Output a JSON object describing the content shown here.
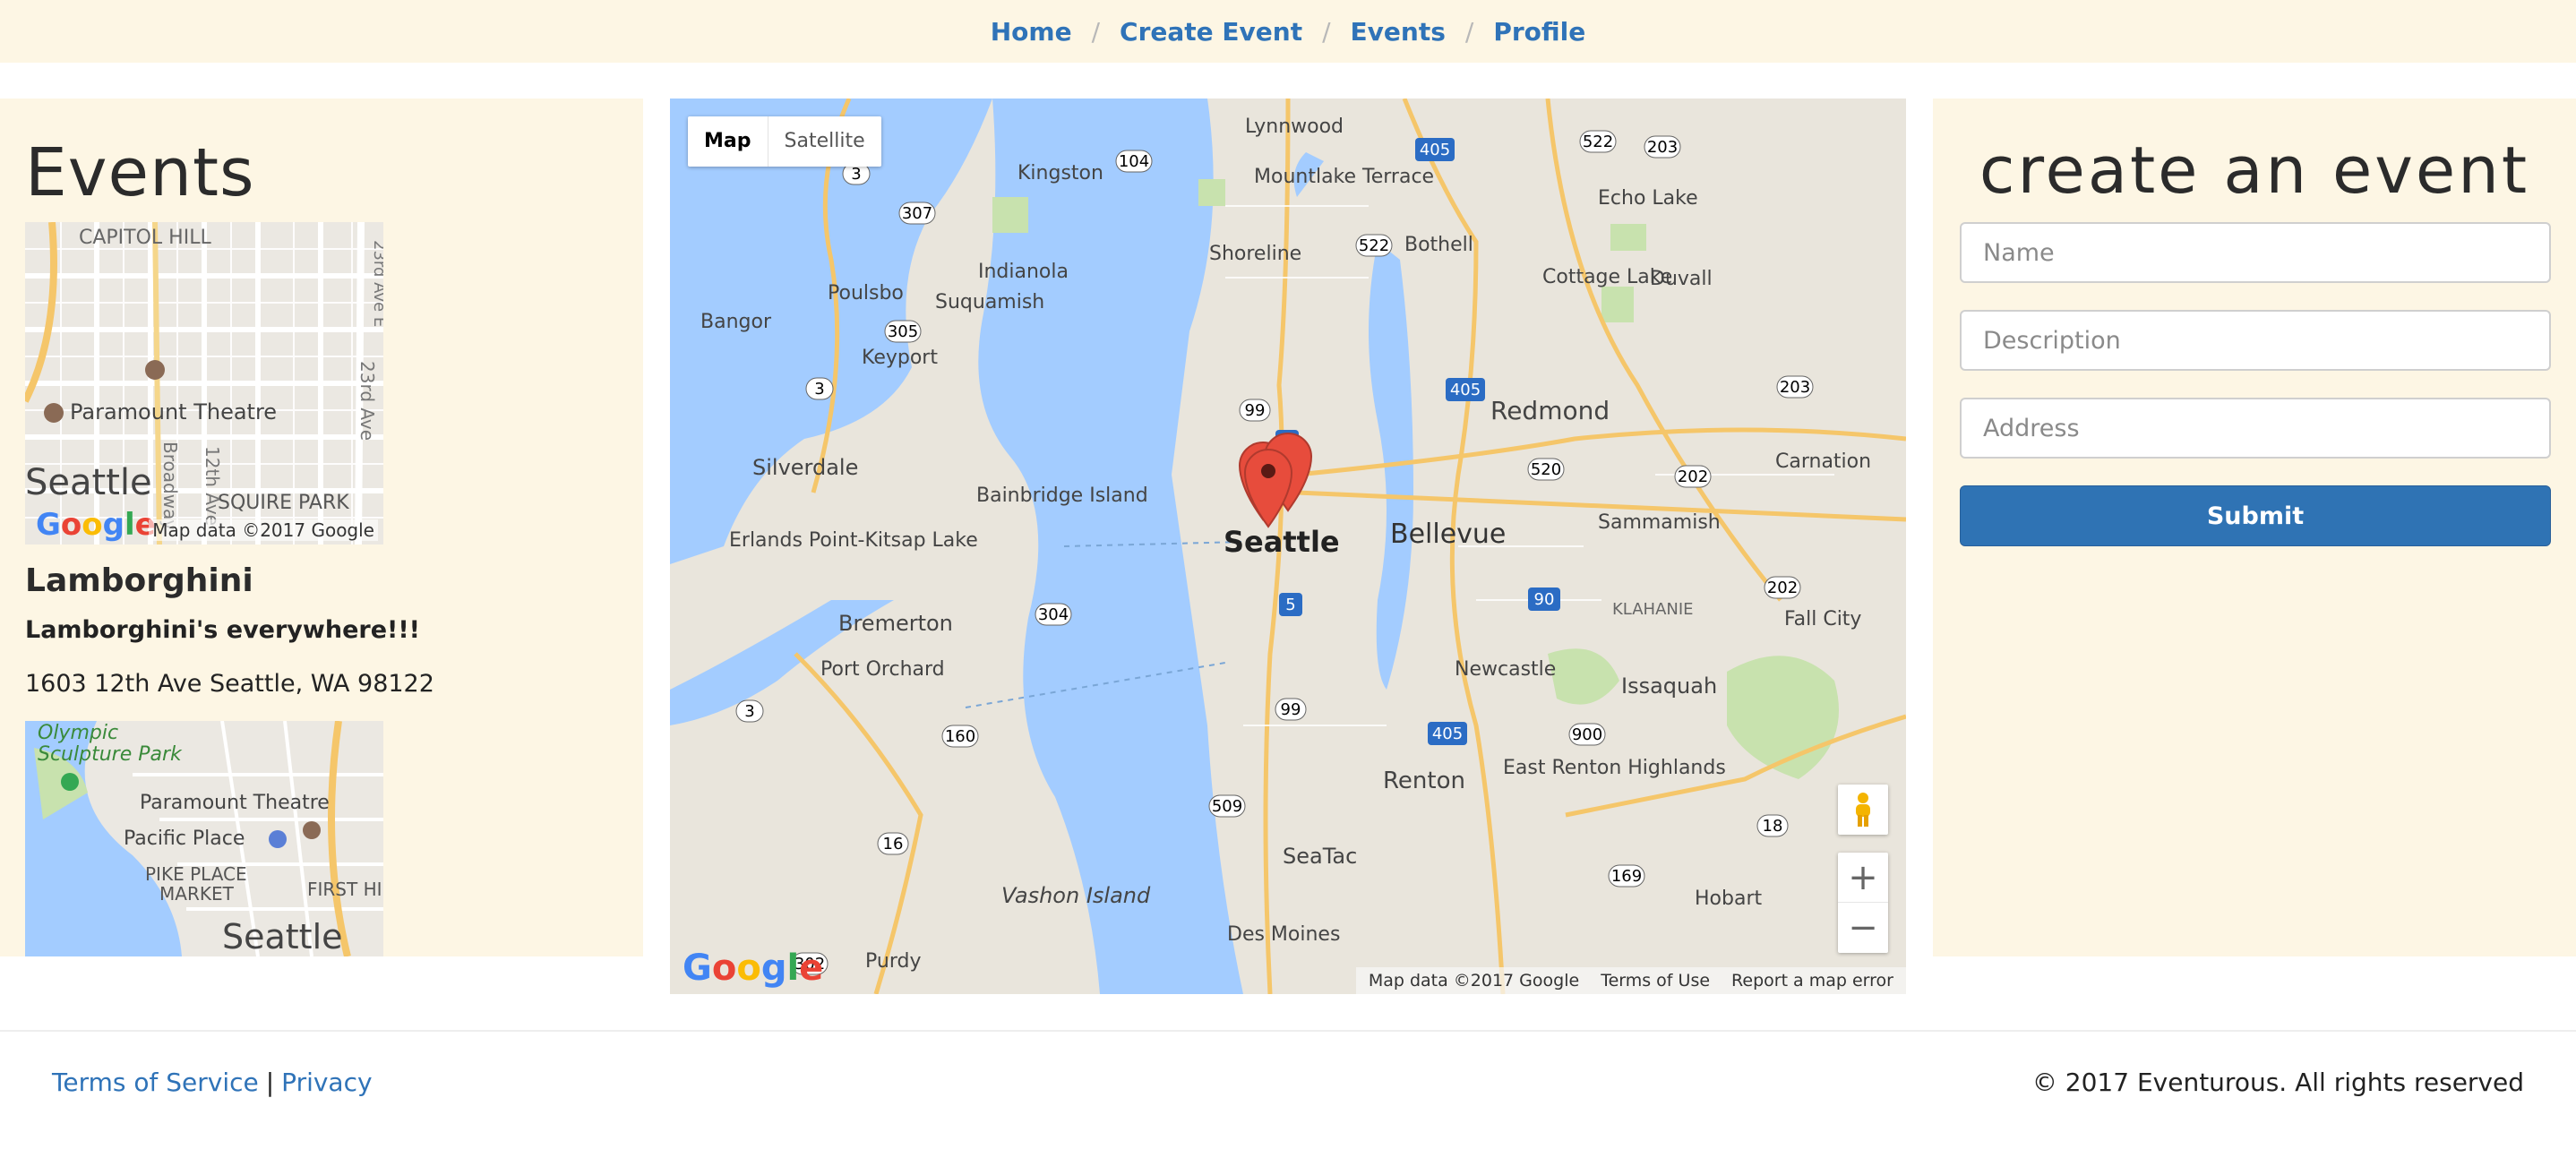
{
  "nav": {
    "items": [
      {
        "label": "Home"
      },
      {
        "label": "Create Event"
      },
      {
        "label": "Events"
      },
      {
        "label": "Profile"
      }
    ],
    "separator": "/"
  },
  "events_panel": {
    "title": "Events",
    "mini_map_1": {
      "labels": [
        "CAPITOL HILL",
        "Paramount Theatre",
        "Seattle",
        "SQUIRE PARK",
        "Broadway",
        "12th Ave",
        "23rd Ave",
        "23rd Ave E"
      ],
      "map_data": "Map data ©2017 Google",
      "logo": "Google"
    },
    "event": {
      "name": "Lamborghini",
      "description": "Lamborghini's everywhere!!!",
      "address": "1603 12th Ave Seattle, WA 98122"
    },
    "mini_map_2": {
      "labels": [
        "Olympic",
        "Sculpture Park",
        "Paramount Theatre",
        "Pacific Place",
        "PIKE PLACE",
        "MARKET",
        "FIRST HIL",
        "Seattle"
      ]
    }
  },
  "main_map": {
    "map_type": {
      "map": "Map",
      "satellite": "Satellite"
    },
    "labels": [
      "Lynnwood",
      "Kingston",
      "Mountlake Terrace",
      "Shoreline",
      "Bothell",
      "Echo Lake",
      "Cottage Lake",
      "Duvall",
      "Indianola",
      "Poulsbo",
      "Suquamish",
      "Bangor",
      "Keyport",
      "Redmond",
      "Carnation",
      "Silverdale",
      "Bainbridge Island",
      "Seattle",
      "Bellevue",
      "Sammamish",
      "Erlands Point-Kitsap Lake",
      "Bremerton",
      "KLAHANIE",
      "Fall City",
      "Port Orchard",
      "Newcastle",
      "Issaquah",
      "Renton",
      "East Renton Highlands",
      "SeaTac",
      "Hobart",
      "Vashon Island",
      "Des Moines",
      "Purdy"
    ],
    "highway_shields": [
      "104",
      "3",
      "307",
      "305",
      "3",
      "99",
      "5",
      "522",
      "405",
      "522",
      "203",
      "405",
      "520",
      "202",
      "203",
      "304",
      "90",
      "202",
      "3",
      "160",
      "99",
      "405",
      "900",
      "5",
      "509",
      "16",
      "169",
      "18",
      "302"
    ],
    "footer": [
      "Map data ©2017 Google",
      "Terms of Use",
      "Report a map error"
    ],
    "logo": "Google",
    "zoom_in": "+",
    "zoom_out": "−"
  },
  "create_panel": {
    "title": "create an event",
    "name_placeholder": "Name",
    "description_placeholder": "Description",
    "address_placeholder": "Address",
    "submit_label": "Submit"
  },
  "footer": {
    "terms": "Terms of Service",
    "divider": "|",
    "privacy": "Privacy",
    "copyright": "© 2017 Eventurous. All rights reserved"
  },
  "colors": {
    "panel_bg": "#fdf6e4",
    "link": "#2f73b8",
    "primary_button": "#2f73b4",
    "water": "#a3ccff",
    "land": "#e9e5dc",
    "park": "#c8e2ae",
    "marker": "#e74c3c"
  }
}
